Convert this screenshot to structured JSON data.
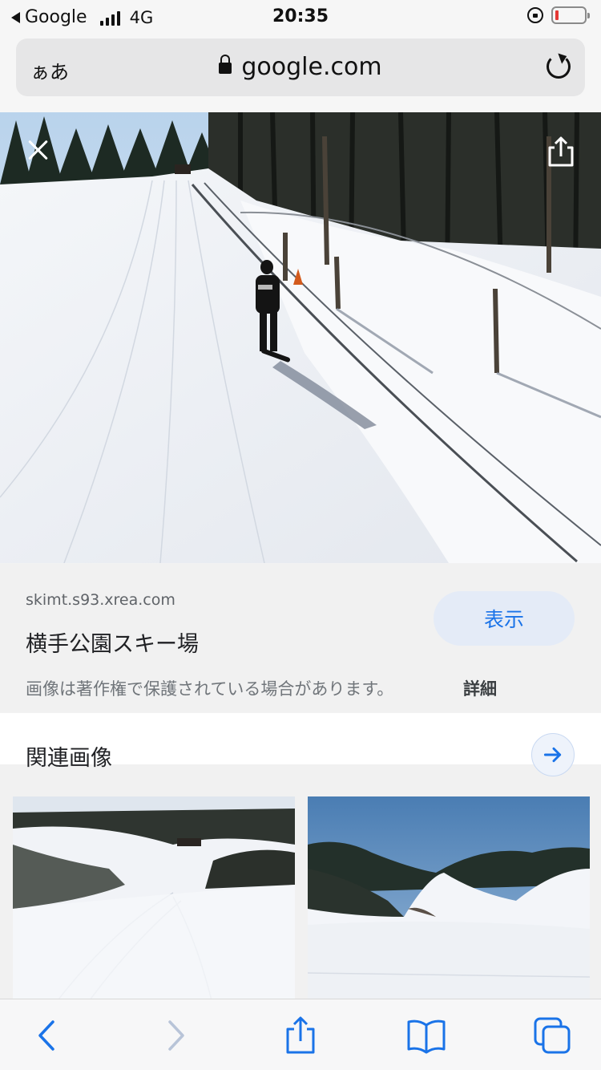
{
  "status_bar": {
    "back_app": "Google",
    "network": "4G",
    "time": "20:35"
  },
  "url_bar": {
    "text_size_label": "ぁあ",
    "domain": "google.com"
  },
  "image_viewer": {
    "site": "skimt.s93.xrea.com",
    "title": "横手公園スキー場",
    "view_button": "表示",
    "copyright_notice": "画像は著作権で保護されている場合があります。",
    "details_link": "詳細"
  },
  "related": {
    "heading": "関連画像"
  },
  "icons": {
    "close": "close-icon",
    "share": "share-icon",
    "arrow": "arrow-right-icon",
    "back": "back-icon",
    "forward": "forward-icon",
    "bookmarks": "book-icon",
    "tabs": "tabs-icon"
  },
  "colors": {
    "accent": "#1a73e8",
    "toolbar_icon": "#1a73e8",
    "toolbar_disabled": "#b8c4d8"
  }
}
